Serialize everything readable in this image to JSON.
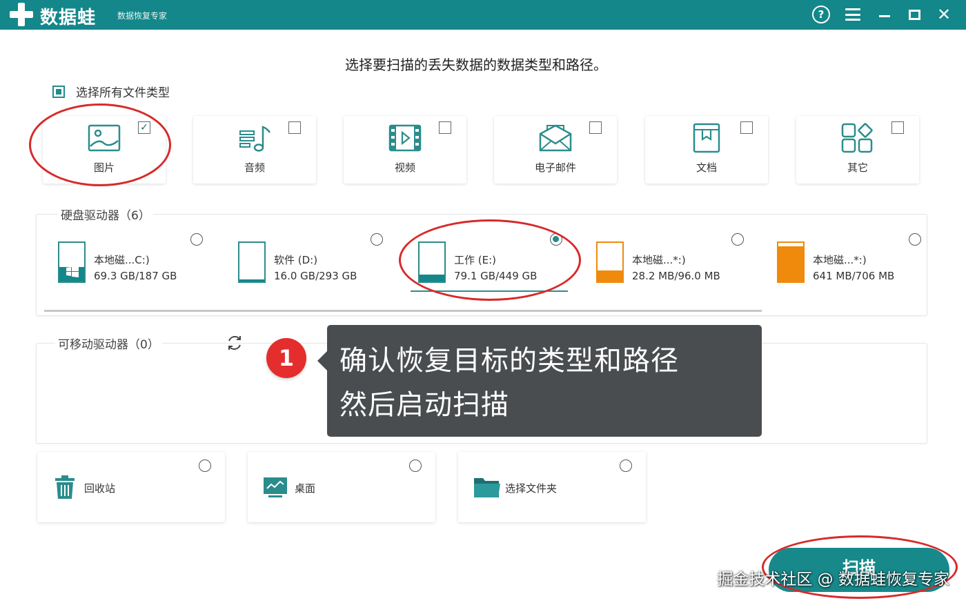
{
  "titlebar": {
    "app_name": "数据蛙",
    "subtitle": "数据恢复专家",
    "help_glyph": "?",
    "close_glyph": "✕"
  },
  "instruction": "选择要扫描的丢失数据的数据类型和路径。",
  "select_all": {
    "label": "选择所有文件类型",
    "checked": true
  },
  "file_types": [
    {
      "label": "图片",
      "icon": "image-icon",
      "checked": true
    },
    {
      "label": "音频",
      "icon": "music-icon",
      "checked": false
    },
    {
      "label": "视频",
      "icon": "video-icon",
      "checked": false
    },
    {
      "label": "电子邮件",
      "icon": "email-icon",
      "checked": false
    },
    {
      "label": "文档",
      "icon": "document-icon",
      "checked": false
    },
    {
      "label": "其它",
      "icon": "other-icon",
      "checked": false
    }
  ],
  "hard_drives": {
    "title": "硬盘驱动器（6）",
    "drives": [
      {
        "name": "本地磁...C:)",
        "size": "69.3 GB/187 GB",
        "fill": 0.37,
        "fill_color": "#14878a",
        "selected": false,
        "windows": true
      },
      {
        "name": "软件 (D:)",
        "size": "16.0 GB/293 GB",
        "fill": 0.05,
        "fill_color": "#14878a",
        "selected": false,
        "windows": false
      },
      {
        "name": "工作 (E:)",
        "size": "79.1 GB/449 GB",
        "fill": 0.18,
        "fill_color": "#14878a",
        "selected": true,
        "windows": false
      },
      {
        "name": "本地磁...*:)",
        "size": "28.2 MB/96.0 MB",
        "fill": 0.29,
        "fill_color": "#ef8a0c",
        "selected": false,
        "windows": false
      },
      {
        "name": "本地磁...*:)",
        "size": "641 MB/706 MB",
        "fill": 0.91,
        "fill_color": "#ef8a0c",
        "selected": false,
        "windows": false
      }
    ]
  },
  "removable": {
    "title": "可移动驱动器（0）"
  },
  "locations": [
    {
      "label": "回收站",
      "icon": "recycle-bin-icon"
    },
    {
      "label": "桌面",
      "icon": "desktop-icon"
    },
    {
      "label": "选择文件夹",
      "icon": "folder-icon"
    }
  ],
  "tooltip": {
    "badge": "1",
    "line1": "确认恢复目标的类型和路径",
    "line2": "然后启动扫描"
  },
  "scan_button": "扫描",
  "watermark": "掘金技术社区 @ 数据蛙恢复专家",
  "colors": {
    "accent": "#14878a",
    "annotation": "#d72a2a",
    "orange": "#ef8a0c"
  }
}
